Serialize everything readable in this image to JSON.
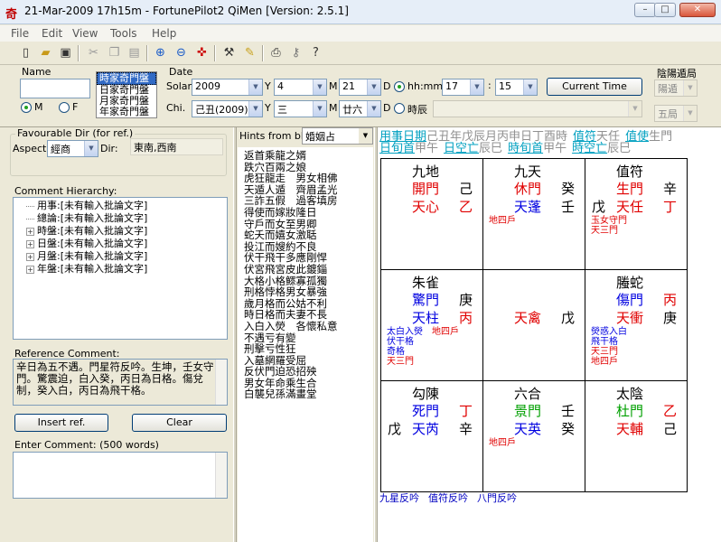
{
  "window": {
    "title": "21-Mar-2009 17h15m - FortunePilot2 QiMen [Version: 2.5.1]",
    "app_icon": "qi-app-icon",
    "controls": [
      "minimize-icon",
      "maximize-icon",
      "close-icon"
    ]
  },
  "menu": [
    "File",
    "Edit",
    "View",
    "Tools",
    "Help"
  ],
  "toolbar_icons": [
    "new-file-icon",
    "open-folder-icon",
    "save-icon",
    "cut-icon",
    "copy-icon",
    "paste-icon",
    "zoom-in-icon",
    "zoom-out-icon",
    "compass-icon",
    "hammer-icon",
    "pencil-icon",
    "print-icon",
    "key-icon",
    "help-icon"
  ],
  "name": {
    "label": "Name",
    "value": ""
  },
  "gender": {
    "m": "M",
    "f": "F",
    "selected": "M"
  },
  "chart_types": [
    "時家奇門盤",
    "日家奇門盤",
    "月家奇門盤",
    "年家奇門盤"
  ],
  "date": {
    "label": "Date",
    "solar_label": "Solar",
    "year": "2009",
    "y": "Y",
    "month": "4",
    "m": "M",
    "day": "21",
    "d": "D",
    "hhmm_label": "hh:mm",
    "hour": "17",
    "colon": ":",
    "minute": "15",
    "current_time_btn": "Current Time",
    "chi_label": "Chi.",
    "chi_year": "己丑(2009)",
    "chi_month": "三",
    "chi_day": "廿六",
    "shichen_label": "時辰",
    "shichen_value": ""
  },
  "yinyang": {
    "label": "陰陽遁局",
    "value": "陽遁",
    "ju": "五局"
  },
  "favourable": {
    "title": "Favourable Dir (for ref.)",
    "aspect_label": "Aspect:",
    "aspect": "經商",
    "dir_label": "Dir:",
    "dir": "東南,西南"
  },
  "comment_hierarchy": {
    "title": "Comment Hierarchy:",
    "items": [
      {
        "text": "用事:[未有輸入批論文字]",
        "expand": false
      },
      {
        "text": "總論:[未有輸入批論文字]",
        "expand": false
      },
      {
        "text": "時盤:[未有輸入批論文字]",
        "expand": true
      },
      {
        "text": "日盤:[未有輸入批論文字]",
        "expand": true
      },
      {
        "text": "月盤:[未有輸入批論文字]",
        "expand": true
      },
      {
        "text": "年盤:[未有輸入批論文字]",
        "expand": true
      }
    ]
  },
  "reference": {
    "title": "Reference Comment:",
    "text": "辛日為五不遇。門星符反吟。生坤，壬女守門。驚震迫，白入癸，丙日為日格。傷兌制，癸入白，丙日為飛干格。"
  },
  "buttons": {
    "insert": "Insert ref.",
    "clear": "Clear"
  },
  "enter_comment": {
    "label": "Enter Comment: (500 words)",
    "value": ""
  },
  "hints": {
    "label": "Hints from bk:",
    "selected": "婚姻占",
    "items": [
      "返首乘龍之婿",
      "跌穴百兩之娘",
      "虎狂龍走　男女相佛",
      "天遁人遁　齊眉孟光",
      "三詐五假　過客填房",
      "得使而嫁妝隆日",
      "守戶而女至男卿",
      "蛇夭而嬉女激聒",
      "投江而嫂約不良",
      "伏干飛干多應剛悍",
      "伏宮飛宮皮此鍍錙",
      "大格小格鰥寡孤獨",
      "刑格悖格男女暴強",
      "歲月格而公姑不利",
      "時日格而夫妻不長",
      "入白入熒　各懷私意",
      "不遇亏有變",
      "刑擊亏性狂",
      "入墓網羅受屈",
      "反伏門迫恐招殃",
      "男女年命乘生合",
      "白襲兒孫滿畫堂"
    ]
  },
  "info": {
    "line1": [
      {
        "t": "用事日期",
        "c": "cyan"
      },
      {
        "t": "己丑年戊辰月丙申日丁酉時",
        "c": "gray"
      },
      {
        "t": "值符",
        "c": "cyan"
      },
      {
        "t": "天任",
        "c": "gray"
      },
      {
        "t": "值使",
        "c": "cyan"
      },
      {
        "t": "生門",
        "c": "gray"
      }
    ],
    "line2": [
      {
        "t": "日旬首",
        "c": "cyan"
      },
      {
        "t": "甲午",
        "c": "gray"
      },
      {
        "t": "日空亡",
        "c": "cyan"
      },
      {
        "t": "辰巳",
        "c": "gray"
      },
      {
        "t": "時旬首",
        "c": "cyan"
      },
      {
        "t": "甲午",
        "c": "gray"
      },
      {
        "t": "時空亡",
        "c": "cyan"
      },
      {
        "t": "辰巳",
        "c": "gray"
      }
    ]
  },
  "grid": {
    "cells": [
      {
        "god": "九地",
        "door": "開門",
        "star": "天心",
        "stem_r1": "己",
        "stem_r2": "乙",
        "stem_left": "",
        "door_c": "red",
        "star_c": "red",
        "r1_c": "blk",
        "r2_c": "red",
        "notes": []
      },
      {
        "god": "九天",
        "door": "休門",
        "star": "天蓬",
        "stem_r1": "癸",
        "stem_r2": "壬",
        "stem_left": "",
        "door_c": "red",
        "star_c": "blue",
        "r1_c": "blk",
        "r2_c": "blk",
        "notes": [
          {
            "t": "地四戶",
            "c": "red"
          }
        ]
      },
      {
        "god": "值符",
        "door": "生門",
        "star": "天任",
        "stem_r1": "辛",
        "stem_r2": "丁",
        "stem_left": "戊",
        "door_c": "red",
        "star_c": "red",
        "r1_c": "blk",
        "r2_c": "red",
        "notes": [
          {
            "t": "玉女守門",
            "c": "red"
          },
          {
            "t": "天三門",
            "c": "red"
          }
        ]
      },
      {
        "god": "朱雀",
        "door": "驚門",
        "star": "天柱",
        "stem_r1": "庚",
        "stem_r2": "丙",
        "stem_left": "",
        "door_c": "blue",
        "star_c": "blue",
        "r1_c": "blk",
        "r2_c": "red",
        "notes": [
          {
            "t": "太白入熒",
            "c": "blue"
          },
          {
            "t": "地四戶",
            "c": "red"
          },
          {
            "t": "伏干格",
            "c": "blue"
          },
          {
            "t": "奇格",
            "c": "blue"
          },
          {
            "t": "天三門",
            "c": "red"
          }
        ]
      },
      {
        "god": "",
        "door": "",
        "star": "天禽",
        "stem_r1": "",
        "stem_r2": "戊",
        "stem_left": "",
        "door_c": "red",
        "star_c": "red",
        "r1_c": "blk",
        "r2_c": "blk",
        "notes": []
      },
      {
        "god": "螣蛇",
        "door": "傷門",
        "star": "天衝",
        "stem_r1": "丙",
        "stem_r2": "庚",
        "stem_left": "",
        "door_c": "blue",
        "star_c": "red",
        "r1_c": "red",
        "r2_c": "blk",
        "notes": [
          {
            "t": "熒惑入白",
            "c": "blue"
          },
          {
            "t": "飛干格",
            "c": "blue"
          },
          {
            "t": "天三門",
            "c": "red"
          },
          {
            "t": "地四戶",
            "c": "red"
          }
        ]
      },
      {
        "god": "勾陳",
        "door": "死門",
        "star": "天芮",
        "stem_r1": "丁",
        "stem_r2": "辛",
        "stem_left": "戊",
        "door_c": "blue",
        "star_c": "blue",
        "r1_c": "red",
        "r2_c": "blk",
        "notes": []
      },
      {
        "god": "六合",
        "door": "景門",
        "star": "天英",
        "stem_r1": "壬",
        "stem_r2": "癸",
        "stem_left": "",
        "door_c": "green",
        "star_c": "blue",
        "r1_c": "blk",
        "r2_c": "blk",
        "notes": [
          {
            "t": "地四戶",
            "c": "red"
          }
        ]
      },
      {
        "god": "太陰",
        "door": "杜門",
        "star": "天輔",
        "stem_r1": "乙",
        "stem_r2": "己",
        "stem_left": "",
        "door_c": "green",
        "star_c": "red",
        "r1_c": "red",
        "r2_c": "blk",
        "notes": []
      }
    ]
  },
  "footer_notes": [
    "九星反吟",
    "值符反吟",
    "八門反吟"
  ],
  "colors": {
    "red": "#e00000",
    "blue": "#0000e0",
    "green": "#00a000",
    "cyan": "#00a0c0",
    "gray": "#909090"
  }
}
